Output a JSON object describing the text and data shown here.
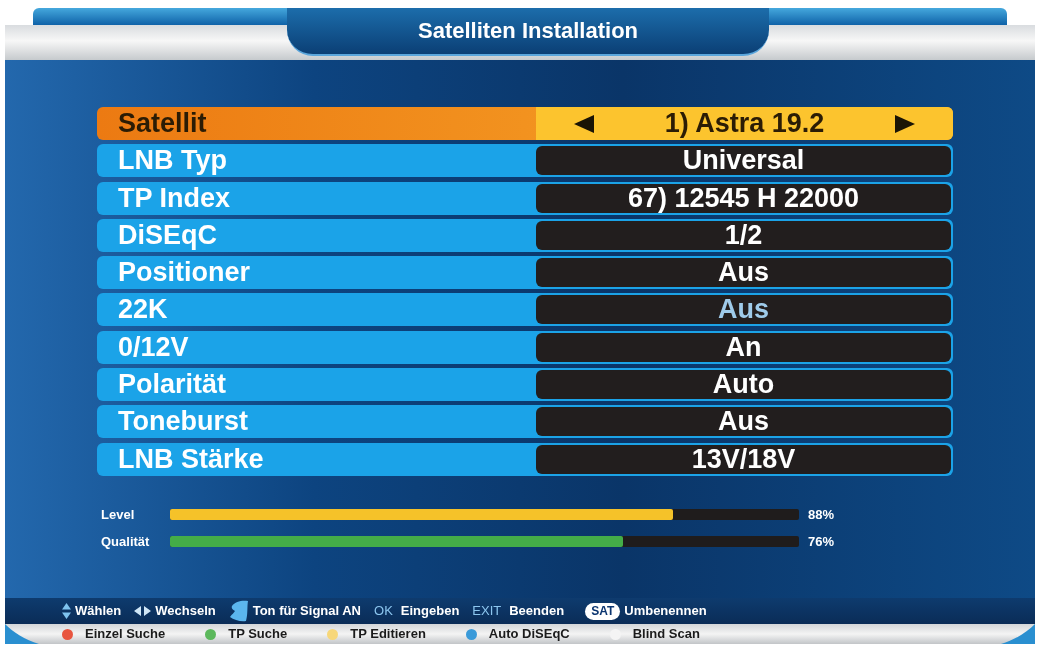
{
  "window": {
    "title": "Satelliten Installation"
  },
  "rows": [
    {
      "label": "Satellit",
      "value": "1) Astra 19.2",
      "selected": true,
      "disabled": false
    },
    {
      "label": "LNB Typ",
      "value": "Universal",
      "selected": false,
      "disabled": false
    },
    {
      "label": "TP Index",
      "value": "67) 12545 H 22000",
      "selected": false,
      "disabled": false
    },
    {
      "label": "DiSEqC",
      "value": "1/2",
      "selected": false,
      "disabled": false
    },
    {
      "label": "Positioner",
      "value": "Aus",
      "selected": false,
      "disabled": false
    },
    {
      "label": "22K",
      "value": "Aus",
      "selected": false,
      "disabled": true
    },
    {
      "label": "0/12V",
      "value": "An",
      "selected": false,
      "disabled": false
    },
    {
      "label": "Polarität",
      "value": "Auto",
      "selected": false,
      "disabled": false
    },
    {
      "label": "Toneburst",
      "value": "Aus",
      "selected": false,
      "disabled": false
    },
    {
      "label": "LNB Stärke",
      "value": "13V/18V",
      "selected": false,
      "disabled": false
    }
  ],
  "meters": [
    {
      "label": "Level",
      "level": 0.8,
      "reading": "88%",
      "color": "#f5c229"
    },
    {
      "label": "Qualität",
      "level": 0.72,
      "reading": "76%",
      "color": "#44ad48"
    }
  ],
  "help_bar": [
    {
      "kind": "updown",
      "label": "Wählen"
    },
    {
      "kind": "leftright",
      "label": "Wechseln"
    },
    {
      "kind": "blob",
      "label": "Ton für Signal AN"
    },
    {
      "kind": "key",
      "key": "OK",
      "label": "Eingeben"
    },
    {
      "kind": "key",
      "key": "EXIT",
      "label": "Beenden"
    },
    {
      "kind": "pill",
      "key": "SAT",
      "label": "Umbenennen"
    }
  ],
  "color_keys": [
    {
      "label": "Einzel Suche",
      "color": "#e8553f"
    },
    {
      "label": "TP Suche",
      "color": "#5cb85c"
    },
    {
      "label": "TP Editieren",
      "color": "#f7d77a"
    },
    {
      "label": "Auto DiSEqC",
      "color": "#3a9ad9"
    },
    {
      "label": "Blind Scan",
      "color": "#f4f4f4"
    }
  ]
}
